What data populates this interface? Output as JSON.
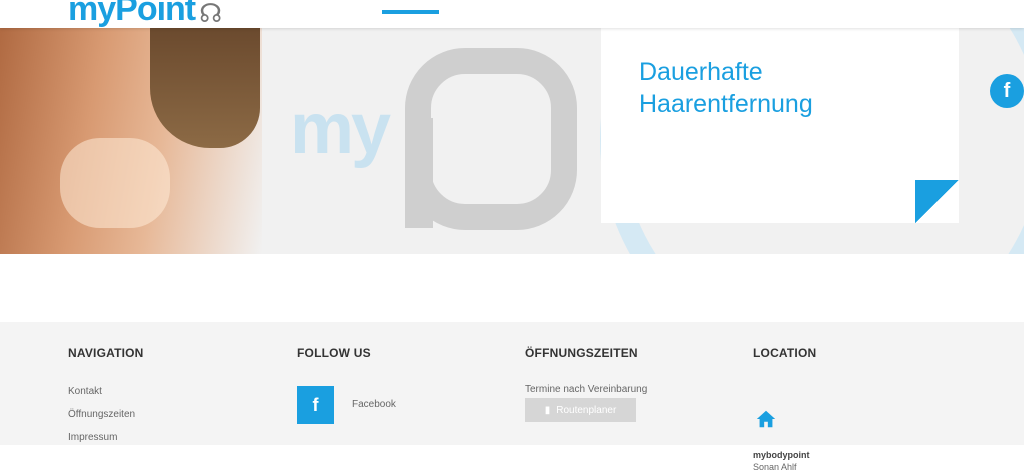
{
  "header": {
    "logo_text": "myPoint",
    "logo_icon": "figure-icon"
  },
  "hero": {
    "title_line1": "Dauerhafte",
    "title_line2": "Haarentfernung",
    "facebook_icon": "f",
    "watermark": "my"
  },
  "footer": {
    "navigation": {
      "heading": "NAVIGATION",
      "links": [
        "Kontakt",
        "Öffnungszeiten",
        "Impressum"
      ]
    },
    "follow": {
      "heading": "FOLLOW US",
      "facebook_icon": "f",
      "facebook_label": "Facebook"
    },
    "hours": {
      "heading": "ÖFFNUNGSZEITEN",
      "text": "Termine nach Vereinbarung",
      "route_button": "Routenplaner"
    },
    "location": {
      "heading": "LOCATION",
      "name": "mybodypoint",
      "street": "Sonan Ahlf"
    }
  },
  "colors": {
    "accent": "#1a9fe0",
    "footer_bg": "#f4f4f4",
    "hero_bg": "#f1f1f1"
  }
}
